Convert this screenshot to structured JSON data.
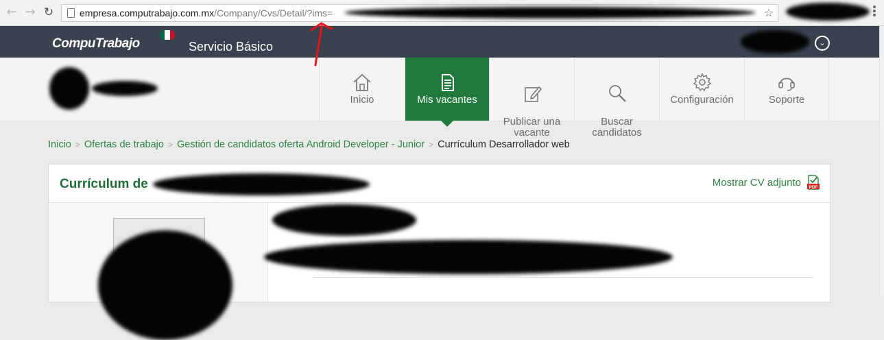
{
  "browser": {
    "url_host": "empresa.computrabajo.com.mx",
    "url_path": "/Company/Cvs/Detail/?ims=",
    "icons": [
      "back-icon",
      "forward-icon",
      "reload-icon",
      "page-icon",
      "star-icon",
      "menu-icon"
    ]
  },
  "topbar": {
    "logo": "CompuTrabajo",
    "service": "Servicio Básico",
    "flag_colors": [
      "#006847",
      "#ffffff",
      "#ce1126"
    ]
  },
  "nav": {
    "items": [
      {
        "label": "Inicio",
        "icon": "home-icon"
      },
      {
        "label": "Mis vacantes",
        "icon": "document-icon",
        "active": true
      },
      {
        "label": "Publicar una\nvacante",
        "icon": "edit-icon"
      },
      {
        "label": "Buscar\ncandidatos",
        "icon": "search-icon"
      },
      {
        "label": "Configuración",
        "icon": "gear-icon"
      },
      {
        "label": "Soporte",
        "icon": "headset-icon"
      }
    ]
  },
  "breadcrumb": {
    "items": [
      "Inicio",
      "Ofertas de trabajo",
      "Gestión de candidatos oferta Android Developer - Junior"
    ],
    "current": "Currículum Desarrollador web",
    "separator": ">"
  },
  "card": {
    "title": "Currículum de",
    "show_cv": "Mostrar CV adjunto",
    "pdf_label": "PDF"
  },
  "colors": {
    "brand_green": "#1f7a3c",
    "link_green": "#2e8540",
    "topbar": "#39424f",
    "annotation": "#e8141b"
  }
}
